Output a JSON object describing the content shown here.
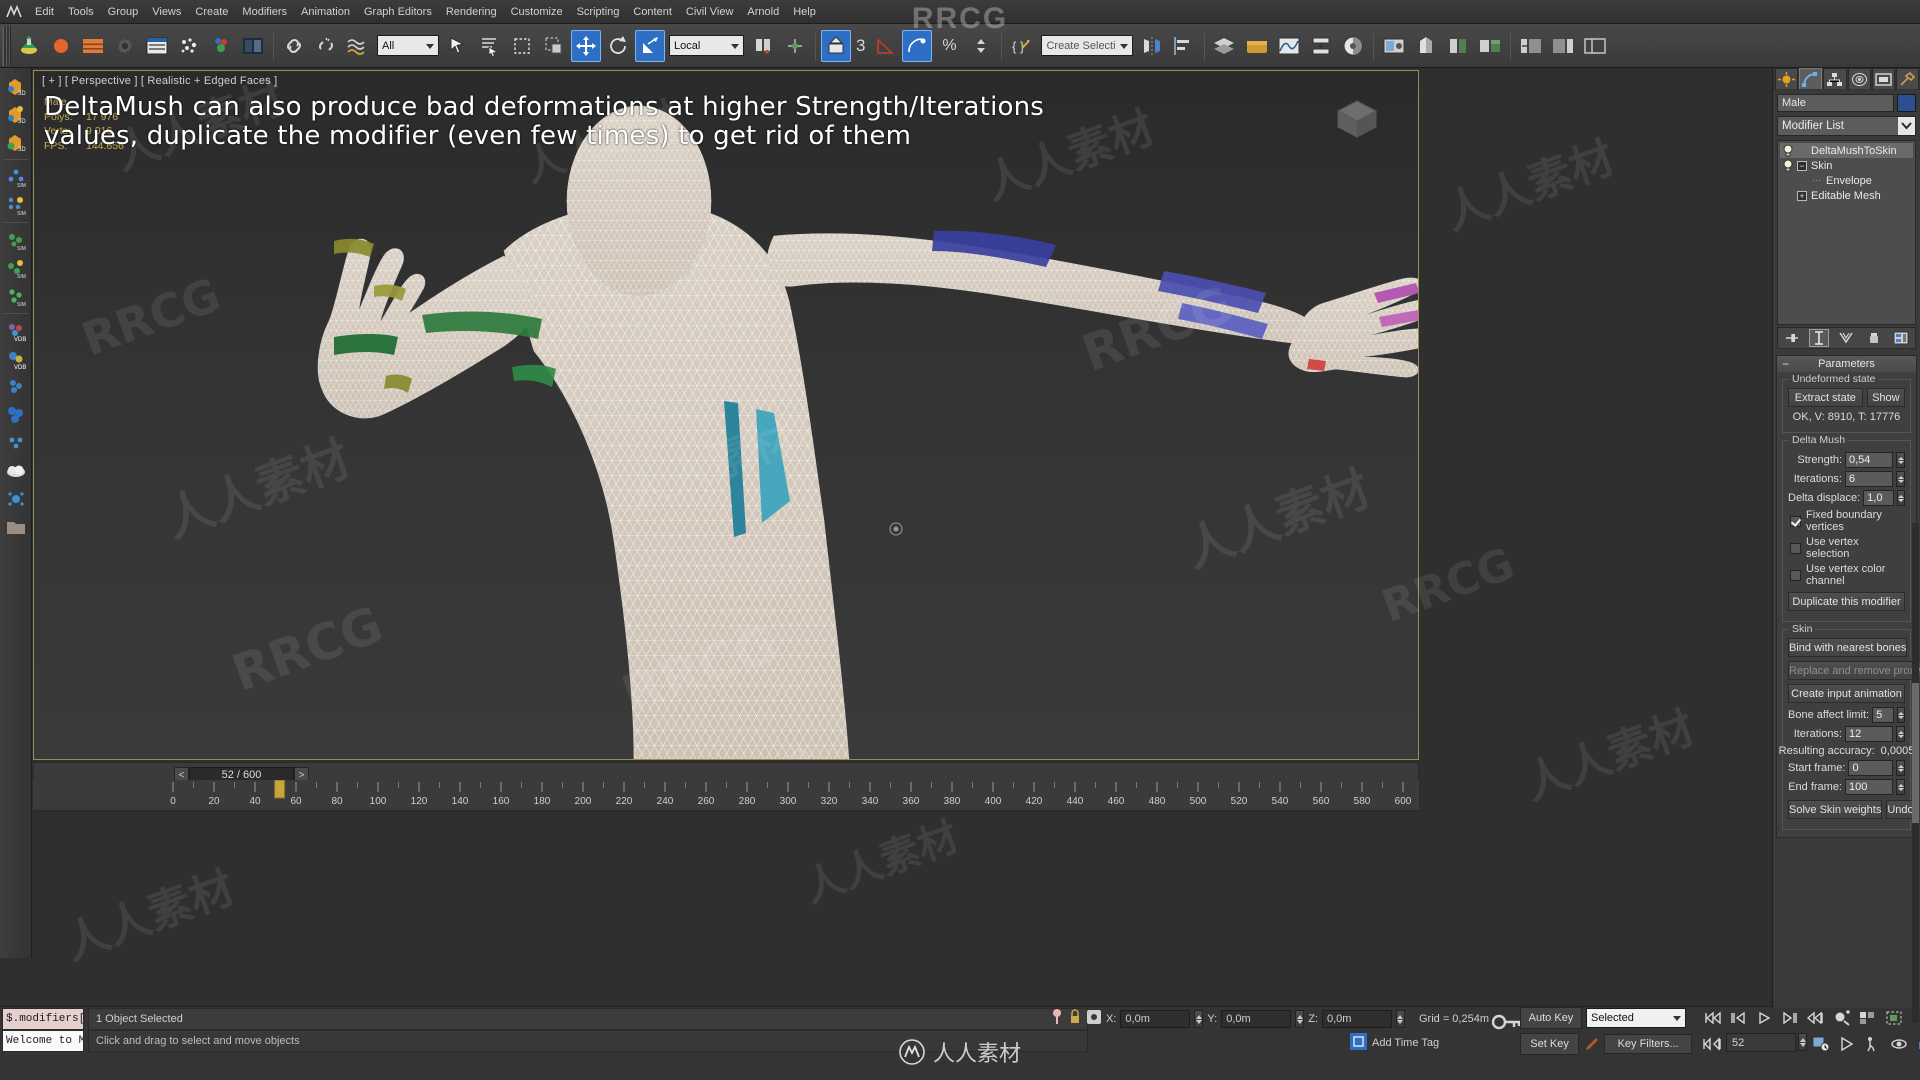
{
  "app": {
    "title": "Autodesk 3ds Max"
  },
  "menubar": {
    "items": [
      "Edit",
      "Tools",
      "Group",
      "Views",
      "Create",
      "Modifiers",
      "Animation",
      "Graph Editors",
      "Rendering",
      "Customize",
      "Scripting",
      "Content",
      "Civil View",
      "Arnold",
      "Help"
    ]
  },
  "toolbar": {
    "select_filter": "All",
    "reference_coord": "Local",
    "selection_set_placeholder": "Create Selection Se",
    "snap_number": "3",
    "icons": [
      "undo-icon",
      "redo-icon",
      "select-link-icon",
      "unlink-icon",
      "bind-space-warp-icon",
      "select-object-icon",
      "select-by-name-icon",
      "rectangular-region-icon",
      "window-crossing-icon",
      "select-and-move-icon",
      "select-and-rotate-icon",
      "select-and-scale-icon",
      "use-pivot-center-icon",
      "align-icon",
      "snap-toggle-icon",
      "angle-snap-icon",
      "percent-snap-icon",
      "spinner-snap-icon",
      "edit-named-selection-icon",
      "mirror-icon",
      "align-icon2",
      "layer-manager-icon",
      "ribbon-icon",
      "curve-editor-icon",
      "schematic-view-icon",
      "material-editor-icon",
      "render-setup-icon",
      "render-frame-icon",
      "render-production-icon"
    ]
  },
  "viewport": {
    "label": "[ + ] [ Perspective ] [ Realistic + Edged Faces ]",
    "stats": {
      "object": "Male",
      "polys_label": "Polys:",
      "polys_value": "17 976",
      "verts_label": "Verts:",
      "verts_value": "9 016",
      "fps_label": "FPS:",
      "fps_value": "144.656"
    },
    "note": "DeltaMush can also produce bad deformations at higher Strength/Iterations values, duplicate the modifier (even few times) to get rid of them"
  },
  "timeline": {
    "current_over_total": "52 / 600",
    "prev_symbol": "<",
    "next_symbol": ">",
    "ruler_ticks": [
      0,
      20,
      40,
      60,
      80,
      100,
      120,
      140,
      160,
      180,
      200,
      220,
      240,
      260,
      280,
      300,
      320,
      340,
      360,
      380,
      400,
      420,
      440,
      460,
      480,
      500,
      520,
      540,
      560,
      580,
      600
    ],
    "slider_frame": 52
  },
  "status": {
    "maxscript_line1": "$.modifiers[",
    "maxscript_line2": "Welcome to M",
    "selection": "1 Object Selected",
    "prompt": "Click and drag to select and move objects",
    "coords": {
      "x_label": "X:",
      "x_value": "0,0m",
      "y_label": "Y:",
      "y_value": "0,0m",
      "z_label": "Z:",
      "z_value": "0,0m"
    },
    "grid": "Grid = 0,254m",
    "add_time_tag": "Add Time Tag",
    "lock_icon": "lock-selection-icon",
    "absolute_icon": "absolute-mode-icon"
  },
  "animation": {
    "auto_key": "Auto Key",
    "set_key": "Set Key",
    "key_mode": "Selected",
    "key_filters": "Key Filters...",
    "current_frame": "52",
    "playback_icons": [
      "go-to-start-icon",
      "previous-frame-icon",
      "play-animation-icon",
      "next-frame-icon",
      "go-to-end-icon",
      "key-mode-toggle-icon"
    ],
    "nav_icons": [
      "zoom-icon",
      "zoom-all-icon",
      "zoom-extents-icon",
      "zoom-extents-all-icon",
      "field-of-view-icon",
      "pan-view-icon",
      "orbit-icon",
      "walkthrough-icon",
      "maximize-viewport-icon"
    ]
  },
  "command_panel": {
    "tabs": [
      "create-tab-icon",
      "modify-tab-icon",
      "hierarchy-tab-icon",
      "motion-tab-icon",
      "display-tab-icon",
      "utilities-tab-icon"
    ],
    "selected_tab_index": 1,
    "object_name": "Male",
    "modifier_list_label": "Modifier List",
    "stack": [
      {
        "label": "DeltaMushToSkin",
        "selected": true,
        "indent": 0,
        "has_toggle": true,
        "expander": "none"
      },
      {
        "label": "Skin",
        "selected": false,
        "indent": 0,
        "has_toggle": true,
        "expander": "minus"
      },
      {
        "label": "Envelope",
        "selected": false,
        "indent": 1,
        "has_toggle": false,
        "expander": "none"
      },
      {
        "label": "Editable Mesh",
        "selected": false,
        "indent": 0,
        "has_toggle": false,
        "expander": "plus"
      }
    ],
    "stack_tools": [
      "pin-stack-icon",
      "show-end-result-icon",
      "make-unique-icon",
      "remove-modifier-icon",
      "configure-modifier-sets-icon"
    ],
    "rollout": {
      "title": "Parameters",
      "undeformed_state": {
        "group_label": "Undeformed state",
        "extract_state": "Extract state",
        "show": "Show",
        "info": "OK, V: 8910, T: 17776"
      },
      "delta_mush": {
        "group_label": "Delta Mush",
        "strength_label": "Strength:",
        "strength_value": "0,54",
        "iterations_label": "Iterations:",
        "iterations_value": "6",
        "delta_displace_label": "Delta displace:",
        "delta_displace_value": "1,0",
        "fixed_boundary_label": "Fixed boundary vertices",
        "fixed_boundary_checked": true,
        "use_vertex_selection_label": "Use vertex selection",
        "use_vertex_selection_checked": false,
        "use_vertex_color_label": "Use vertex color channel",
        "use_vertex_color_checked": false,
        "duplicate_button": "Duplicate this modifier"
      },
      "skin": {
        "group_label": "Skin",
        "bind_button": "Bind with nearest bones",
        "replace_button": "Replace and remove proxy",
        "create_input_button": "Create input animation",
        "bone_affect_label": "Bone affect limit:",
        "bone_affect_value": "5",
        "iterations_label": "Iterations:",
        "iterations_value": "12",
        "accuracy_label": "Resulting accuracy:",
        "accuracy_value": "0,0005",
        "start_frame_label": "Start frame:",
        "start_frame_value": "0",
        "end_frame_label": "End frame:",
        "end_frame_value": "100",
        "solve_button": "Solve Skin weights",
        "undo_button": "Undo"
      }
    }
  },
  "watermark": {
    "top": "RRCG",
    "bottom": "人人素材",
    "tiles": [
      "RRCG",
      "人人素材"
    ]
  },
  "colors": {
    "accent_blue": "#2d6fc4",
    "stat_yellow": "#c8ac4e",
    "viewport_border": "#9a8b4f",
    "panel_bg": "#3a3a3a"
  }
}
